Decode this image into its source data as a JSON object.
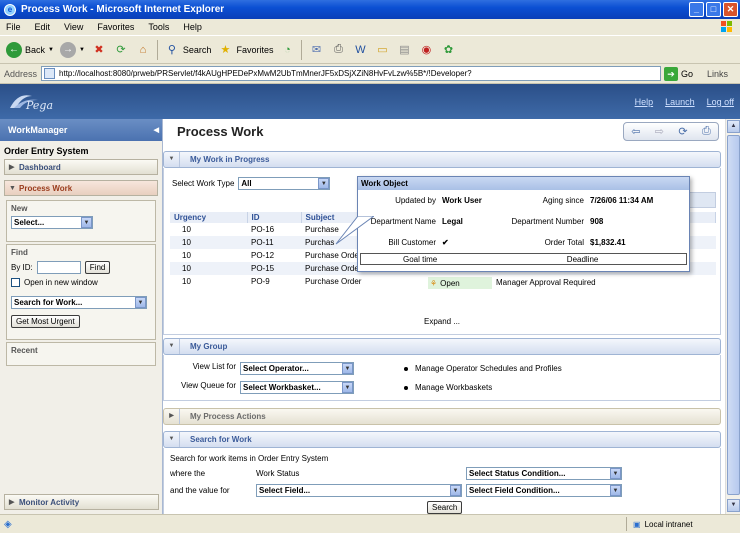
{
  "window": {
    "title": "Process Work - Microsoft Internet Explorer"
  },
  "menu": [
    "File",
    "Edit",
    "View",
    "Favorites",
    "Tools",
    "Help"
  ],
  "toolbar": {
    "back_label": "Back",
    "search_label": "Search",
    "favorites_label": "Favorites"
  },
  "address": {
    "label": "Address",
    "url": "http://localhost:8080/prweb/PRServlet/f4kAUgHPEDePxMwM2UbTmMnerJF5xDSjXZiN8HvFvLzw%5B*/!Developer?",
    "go_label": "Go",
    "links_label": "Links"
  },
  "header": {
    "logo": "Pega",
    "links": [
      "Help",
      "Launch",
      "Log off"
    ]
  },
  "sidebar": {
    "title": "WorkManager",
    "section": "Order Entry System",
    "dashboard": "Dashboard",
    "process_work": "Process Work",
    "new_label": "New",
    "new_select": "Select...",
    "find_label": "Find",
    "byid_label": "By ID:",
    "find_button": "Find",
    "new_window_label": "Open in new window",
    "search_select": "Search for Work...",
    "most_urgent_button": "Get Most Urgent",
    "recent_label": "Recent",
    "monitor": "Monitor Activity"
  },
  "main": {
    "title": "Process Work",
    "wip": {
      "heading": "My Work in Progress",
      "select_type_label": "Select Work Type",
      "select_type_value": "All",
      "columns": [
        "Urgency",
        "ID",
        "Subject"
      ],
      "rows": [
        {
          "urgency": "10",
          "id": "PO-16",
          "subject": "Purchase"
        },
        {
          "urgency": "10",
          "id": "PO-11",
          "subject": "Purchas"
        },
        {
          "urgency": "10",
          "id": "PO-12",
          "subject": "Purchase Orde"
        },
        {
          "urgency": "10",
          "id": "PO-15",
          "subject": "Purchase Orde"
        },
        {
          "urgency": "10",
          "id": "PO-9",
          "subject": "Purchase Order",
          "status": "Open",
          "action": "Manager Approval Required"
        }
      ],
      "expand": "Expand ..."
    },
    "group": {
      "heading": "My Group",
      "view_list_label": "View List for",
      "view_list_value": "Select Operator...",
      "view_queue_label": "View Queue for",
      "view_queue_value": "Select Workbasket...",
      "link1": "Manage Operator Schedules and Profiles",
      "link2": "Manage Workbaskets"
    },
    "actions": {
      "heading": "My Process Actions"
    },
    "search": {
      "heading": "Search for Work",
      "intro": "Search for work items in Order Entry System",
      "where_label": "where the",
      "work_status_label": "Work Status",
      "status_select": "Select Status Condition...",
      "value_label": "and the value for",
      "field_select": "Select Field...",
      "field_cond_select": "Select Field Condition...",
      "search_button": "Search"
    }
  },
  "popup": {
    "title": "Work Object",
    "updated_by_label": "Updated by",
    "updated_by": "Work User",
    "aging_label": "Aging since",
    "aging": "7/26/06 11:34 AM",
    "dept_name_label": "Department Name",
    "dept_name": "Legal",
    "dept_num_label": "Department Number",
    "dept_num": "908",
    "bill_label": "Bill Customer",
    "bill": "✔",
    "total_label": "Order Total",
    "total": "$1,832.41",
    "goal_label": "Goal time",
    "deadline_label": "Deadline"
  },
  "status": {
    "zone": "Local intranet"
  }
}
